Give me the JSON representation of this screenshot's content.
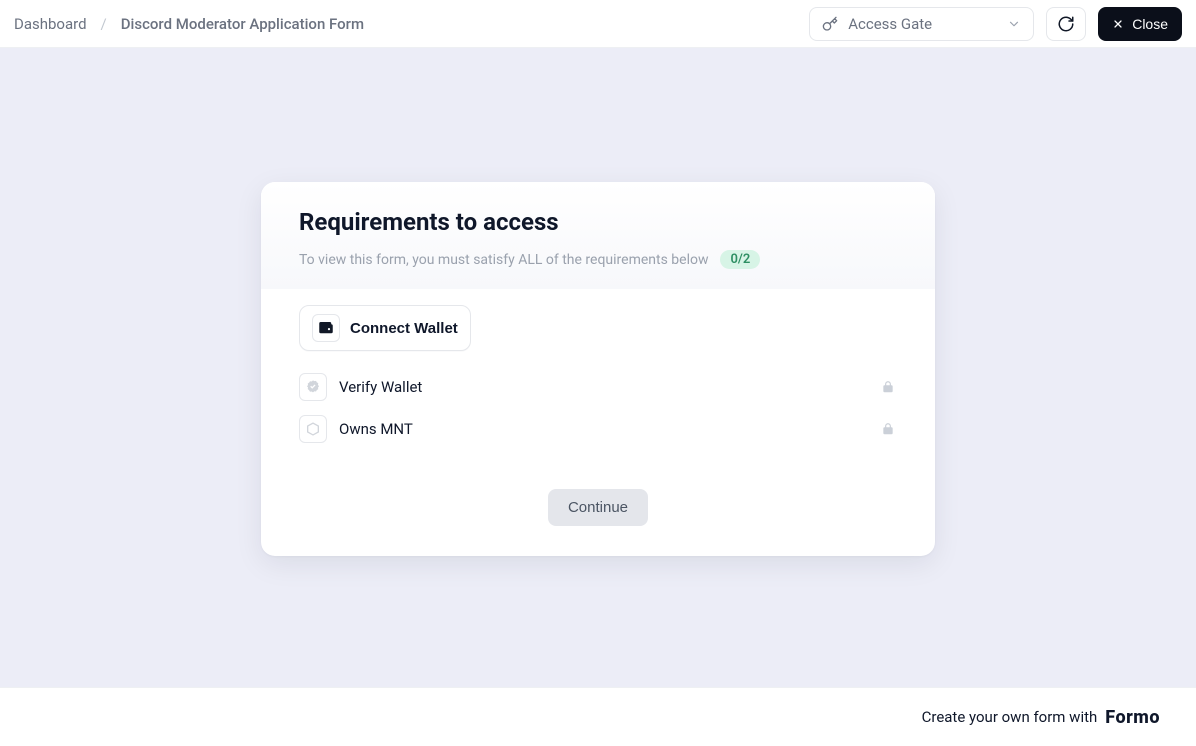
{
  "topbar": {
    "breadcrumbs": {
      "root": "Dashboard",
      "current": "Discord Moderator Application Form"
    },
    "select_label": "Access Gate",
    "close_label": "Close"
  },
  "card": {
    "title": "Requirements to access",
    "subtitle": "To view this form, you must satisfy ALL of the requirements below",
    "progress": "0/2",
    "connect_label": "Connect Wallet",
    "steps": [
      {
        "label": "Verify Wallet"
      },
      {
        "label": "Owns MNT"
      }
    ],
    "continue_label": "Continue"
  },
  "footer": {
    "text": "Create your own form with",
    "brand": "Formo"
  }
}
